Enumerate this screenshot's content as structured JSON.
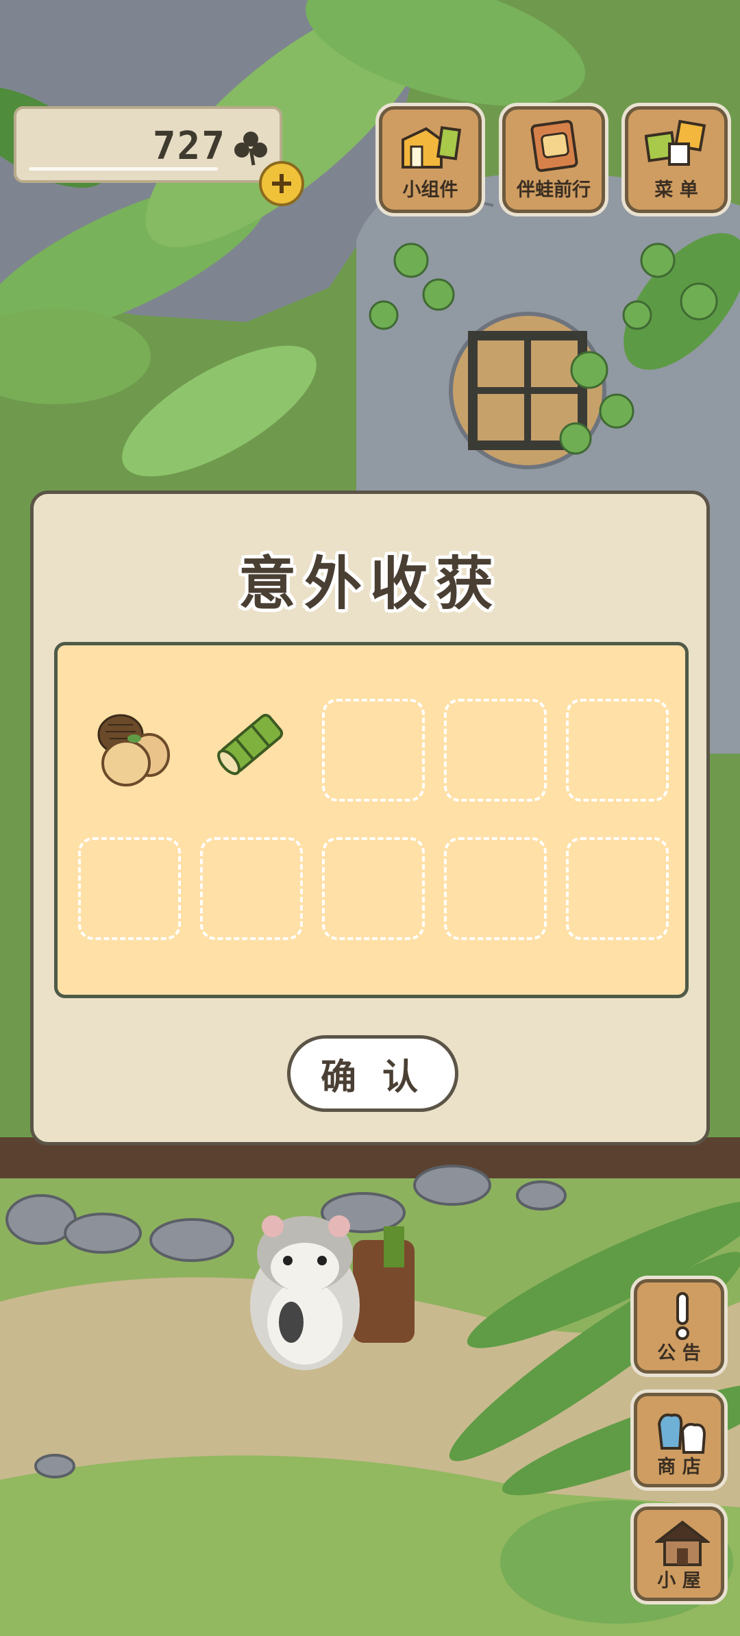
{
  "hud": {
    "clover_count": "727",
    "currency_icon": "clover-icon",
    "add_icon": "plus-icon"
  },
  "top_menu": [
    {
      "id": "widgets",
      "label": "小组件",
      "icon": "widgets-icon"
    },
    {
      "id": "travel-with-frog",
      "label": "伴蛙前行",
      "icon": "book-icon"
    },
    {
      "id": "menu",
      "label": "菜 单",
      "icon": "menu-cards-icon"
    }
  ],
  "side_menu": [
    {
      "id": "notice",
      "label": "公 告",
      "icon": "exclamation-icon"
    },
    {
      "id": "shop",
      "label": "商 店",
      "icon": "bags-icon"
    },
    {
      "id": "house",
      "label": "小 屋",
      "icon": "house-icon"
    }
  ],
  "dialog": {
    "title": "意外收获",
    "items": [
      {
        "name": "acorn-and-nuts",
        "icon": "nuts-icon"
      },
      {
        "name": "bamboo-tube",
        "icon": "bamboo-icon"
      }
    ],
    "total_slots": 10,
    "confirm_label": "确 认"
  },
  "colors": {
    "button_wood": "#cf9d62",
    "dialog_bg": "#ebe1c8",
    "grid_bg": "#ffe0a6",
    "outline": "#5b5447"
  }
}
